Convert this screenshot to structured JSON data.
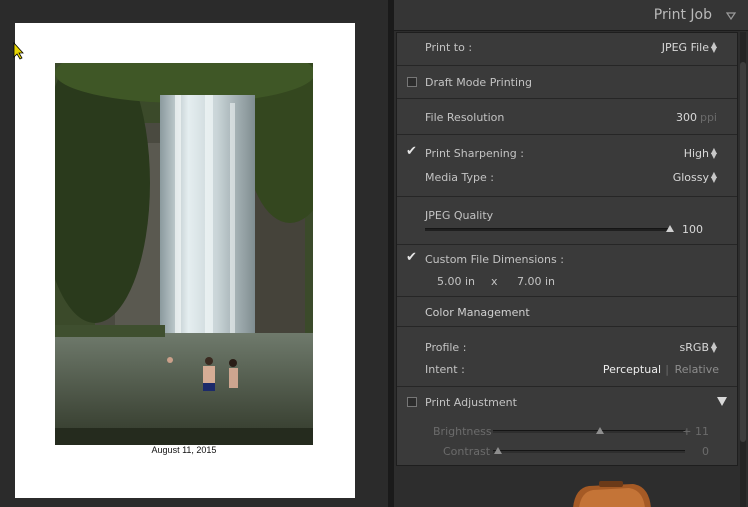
{
  "preview": {
    "caption": "August 11, 2015"
  },
  "panel": {
    "title": "Print Job",
    "print_to": {
      "label": "Print to :",
      "value": "JPEG File"
    },
    "draft_mode": {
      "label": "Draft Mode Printing",
      "checked": false
    },
    "file_resolution": {
      "label": "File Resolution",
      "value": "300",
      "unit": "ppi"
    },
    "print_sharpening": {
      "label": "Print Sharpening :",
      "value": "High",
      "checked": true
    },
    "media_type": {
      "label": "Media Type :",
      "value": "Glossy"
    },
    "jpeg_quality": {
      "label": "JPEG Quality",
      "value": "100",
      "level": 1.0
    },
    "custom_dimensions": {
      "label": "Custom File Dimensions :",
      "width": "5.00 in",
      "separator": "x",
      "height": "7.00 in",
      "checked": true
    },
    "color_management": {
      "title": "Color Management"
    },
    "profile": {
      "label": "Profile :",
      "value": "sRGB"
    },
    "intent": {
      "label": "Intent :",
      "option_active": "Perceptual",
      "option_inactive": "Relative"
    },
    "print_adjustment": {
      "label": "Print Adjustment",
      "checked": false
    },
    "brightness": {
      "label": "Brightness",
      "value": "+ 11",
      "level": 0.55
    },
    "contrast": {
      "label": "Contrast",
      "value": "0",
      "level": 0.0
    }
  },
  "colors": {
    "panel_bg": "#3a3a3a",
    "header_bg": "#353535",
    "page_white": "#ffffff"
  }
}
